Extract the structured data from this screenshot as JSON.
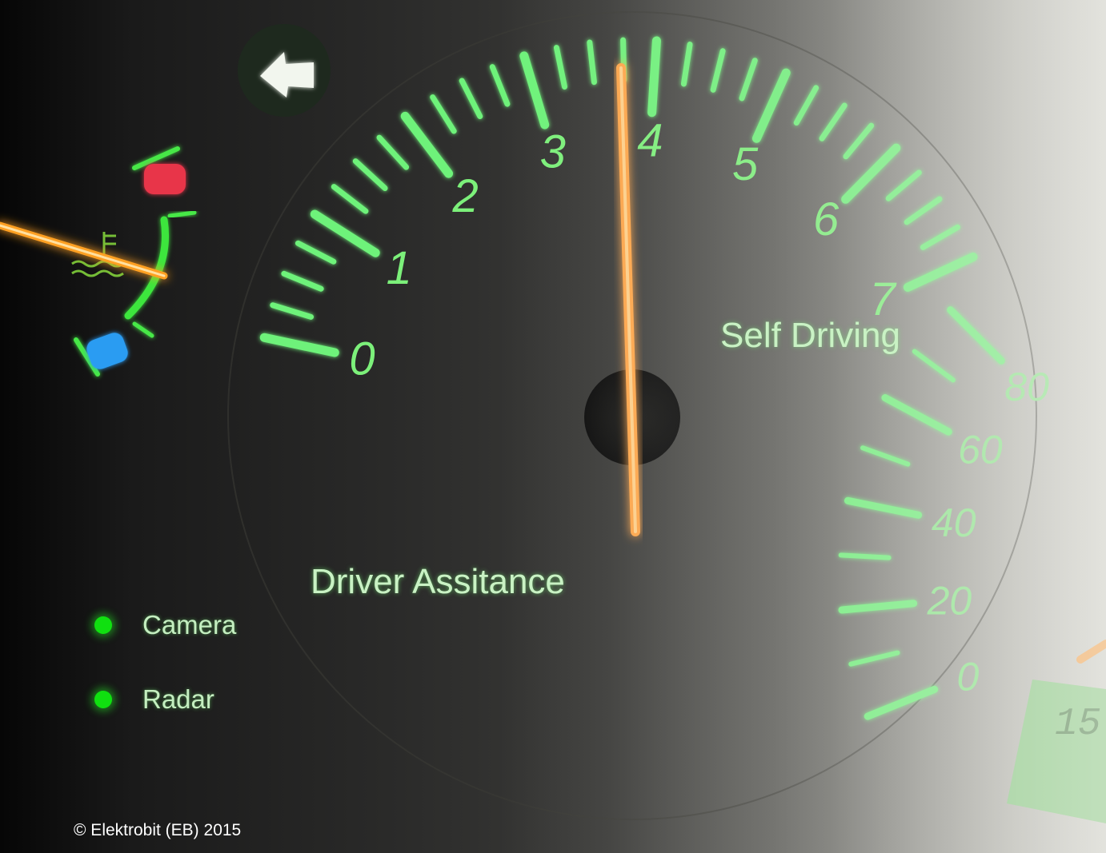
{
  "modes": {
    "driver_assistance": "Driver Assitance",
    "self_driving": "Self Driving"
  },
  "sensors": [
    {
      "label": "Camera",
      "color": "#10e010"
    },
    {
      "label": "Radar",
      "color": "#10e010"
    }
  ],
  "tachometer": {
    "labels": [
      "0",
      "1",
      "2",
      "3",
      "4",
      "5",
      "6",
      "7"
    ]
  },
  "speedometer": {
    "labels": [
      "0",
      "20",
      "40",
      "60",
      "80"
    ]
  },
  "lcd": {
    "text": "15"
  },
  "copyright": "© Elektrobit (EB) 2015",
  "colors": {
    "gauge_green": "#6ef27a",
    "needle": "#ffa64a",
    "warning_red": "#e8364a",
    "warning_blue": "#2a9cf2",
    "lcd_green": "#7fd07a"
  },
  "icons": [
    "arrow-indicator-icon",
    "temperature-icon"
  ]
}
